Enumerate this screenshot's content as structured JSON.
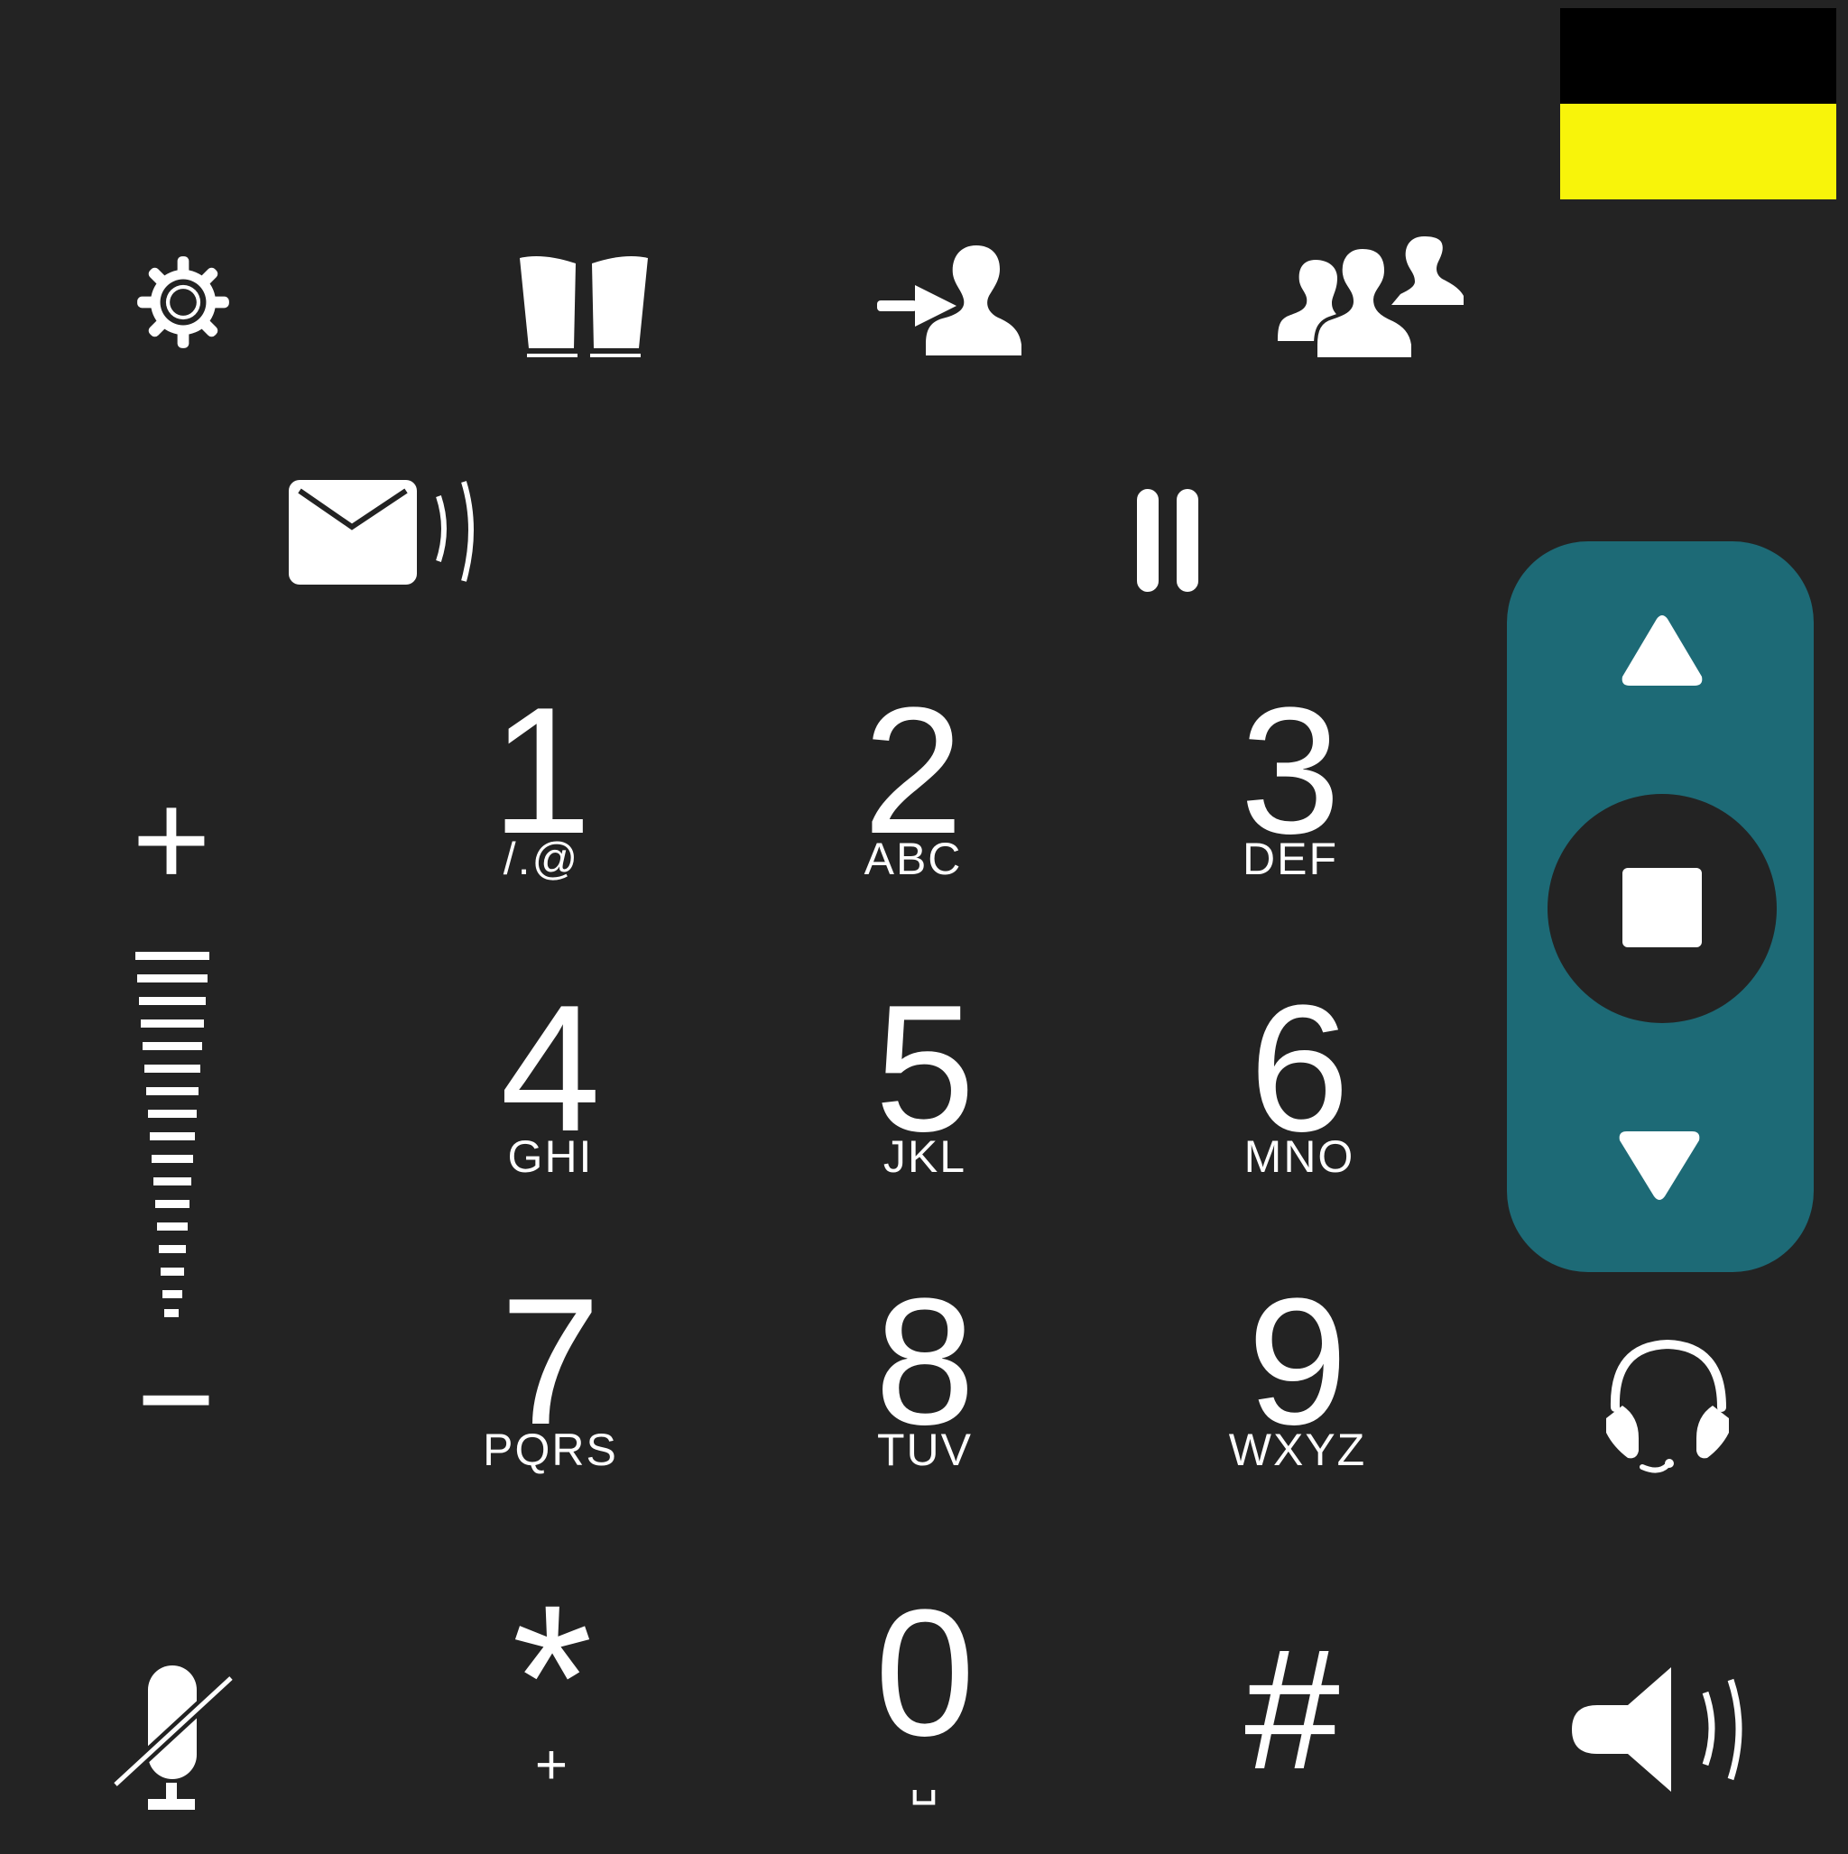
{
  "toolbar": {
    "icons": [
      "gear-icon",
      "phonebook-icon",
      "call-transfer-icon",
      "conference-icon"
    ]
  },
  "actions": {
    "icons": [
      "voicemail-icon",
      "hold-icon"
    ]
  },
  "keypad": {
    "keys": [
      {
        "digit": "1",
        "letters": "/.@"
      },
      {
        "digit": "2",
        "letters": "ABC"
      },
      {
        "digit": "3",
        "letters": "DEF"
      },
      {
        "digit": "4",
        "letters": "GHI"
      },
      {
        "digit": "5",
        "letters": "JKL"
      },
      {
        "digit": "6",
        "letters": "MNO"
      },
      {
        "digit": "7",
        "letters": "PQRS"
      },
      {
        "digit": "8",
        "letters": "TUV"
      },
      {
        "digit": "9",
        "letters": "WXYZ"
      },
      {
        "digit": "*",
        "letters": "+"
      },
      {
        "digit": "0",
        "letters": "␣"
      },
      {
        "digit": "#",
        "letters": ""
      }
    ]
  },
  "volume": {
    "plus_label": "+",
    "minus_label": "−"
  },
  "navigation": {
    "icons": [
      "arrow-up-icon",
      "stop-icon",
      "arrow-down-icon"
    ]
  },
  "bottom": {
    "icons": [
      "mute-microphone-icon",
      "speaker-icon",
      "headset-icon"
    ]
  },
  "colors": {
    "background": "#232323",
    "foreground": "#ffffff",
    "nav_panel": "#1d6a76",
    "flag_top": "#000000",
    "flag_bottom": "#f8f40a"
  }
}
